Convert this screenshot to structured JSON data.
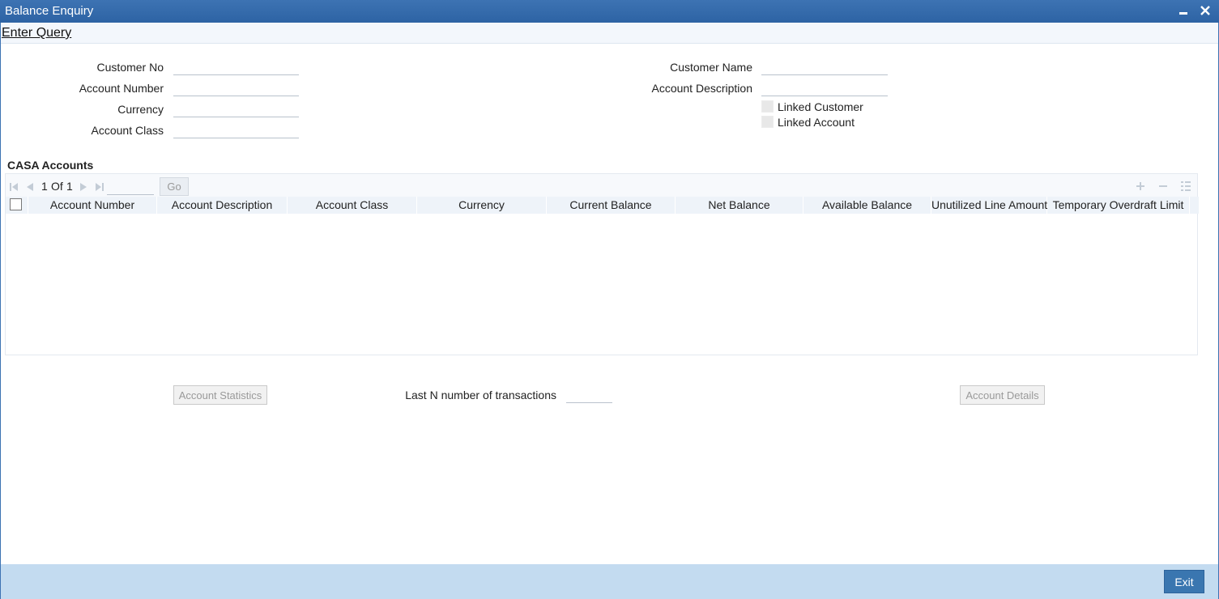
{
  "window": {
    "title": "Balance Enquiry"
  },
  "menu": {
    "enter_query": "Enter Query"
  },
  "form": {
    "customer_no": {
      "label": "Customer No",
      "value": ""
    },
    "account_number": {
      "label": "Account Number",
      "value": ""
    },
    "currency": {
      "label": "Currency",
      "value": ""
    },
    "account_class": {
      "label": "Account Class",
      "value": ""
    },
    "customer_name": {
      "label": "Customer Name",
      "value": ""
    },
    "account_description": {
      "label": "Account Description",
      "value": ""
    },
    "linked_customer": {
      "label": "Linked Customer",
      "checked": false
    },
    "linked_account": {
      "label": "Linked Account",
      "checked": false
    }
  },
  "casa": {
    "title": "CASA Accounts",
    "pager": {
      "current": "1",
      "of_label": "Of",
      "total": "1",
      "go_label": "Go"
    },
    "columns": [
      "Account Number",
      "Account Description",
      "Account Class",
      "Currency",
      "Current Balance",
      "Net Balance",
      "Available Balance",
      "Unutilized Line Amount",
      "Temporary Overdraft Limit"
    ],
    "rows": []
  },
  "actions": {
    "account_statistics": "Account Statistics",
    "last_n_label": "Last N number of transactions",
    "last_n_value": "",
    "account_details": "Account Details"
  },
  "footer": {
    "exit_label": "Exit"
  }
}
